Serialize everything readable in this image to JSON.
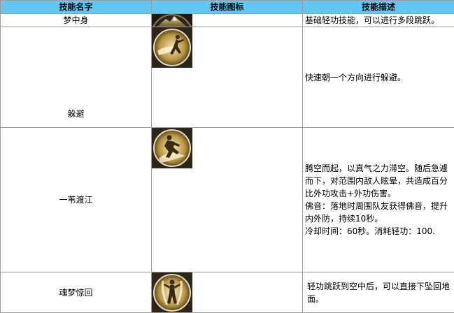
{
  "headers": [
    "技能名字",
    "技能图标",
    "技能描述"
  ],
  "rows": [
    {
      "name": "梦中身",
      "icon": "mountain-skill-icon",
      "desc_lines": [
        "基础轻功技能，可以进行多段跳跃。"
      ]
    },
    {
      "name": "躲避",
      "icon": "dodge-figure-icon",
      "desc_lines": [
        "快速朝一个方向进行躲避。"
      ]
    },
    {
      "name": "一苇渡江",
      "icon": "crouching-figure-icon",
      "desc_lines": [
        "腾空而起，以真气之力滞空。随后急遽",
        "而下，对范围内敌人眩晕，共造成百分",
        "比外功攻击+外功伤害。",
        "佛音：落地时周围队友获得佛音，提升",
        "内外防，持续10秒。",
        "冷却时间：60秒。消耗轻功：100."
      ]
    },
    {
      "name": "魂梦惊回",
      "icon": "leaping-figure-icon",
      "desc_lines": [
        "轻功跳跃到空中后，可以直接下坠回地",
        "面。"
      ]
    }
  ],
  "colors": {
    "header_bg": "#62c7f3",
    "border": "#9c9c9c",
    "icon_gold": "#c9a95a"
  }
}
